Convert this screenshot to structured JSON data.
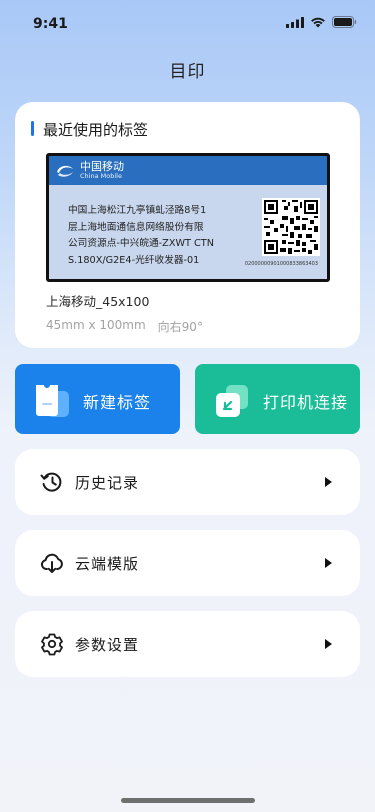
{
  "status": {
    "time": "9:41"
  },
  "app": {
    "title": "目印"
  },
  "recent": {
    "section_title": "最近使用的标签",
    "label": {
      "brand_cn": "中国移动",
      "brand_en": "China Mobile",
      "lines": [
        "中国上海松江九亭镇虬泾路8号1",
        "层上海地面通信息网络股份有限",
        "公司资源点-中兴皖通-ZXWT CTN",
        "S.180X/G2E4-光纤收发器-01"
      ],
      "code": "02000000901000833863403"
    },
    "template_name": "上海移动_45x100",
    "size": "45mm x 100mm",
    "orientation": "向右90°"
  },
  "actions": {
    "new_label": "新建标签",
    "printer_connect": "打印机连接"
  },
  "menu": {
    "history": "历史记录",
    "cloud_templates": "云端模版",
    "settings": "参数设置"
  },
  "colors": {
    "accent_blue": "#1a82ea",
    "accent_green": "#1bbd98",
    "brand_blue": "#2a6fbf"
  }
}
